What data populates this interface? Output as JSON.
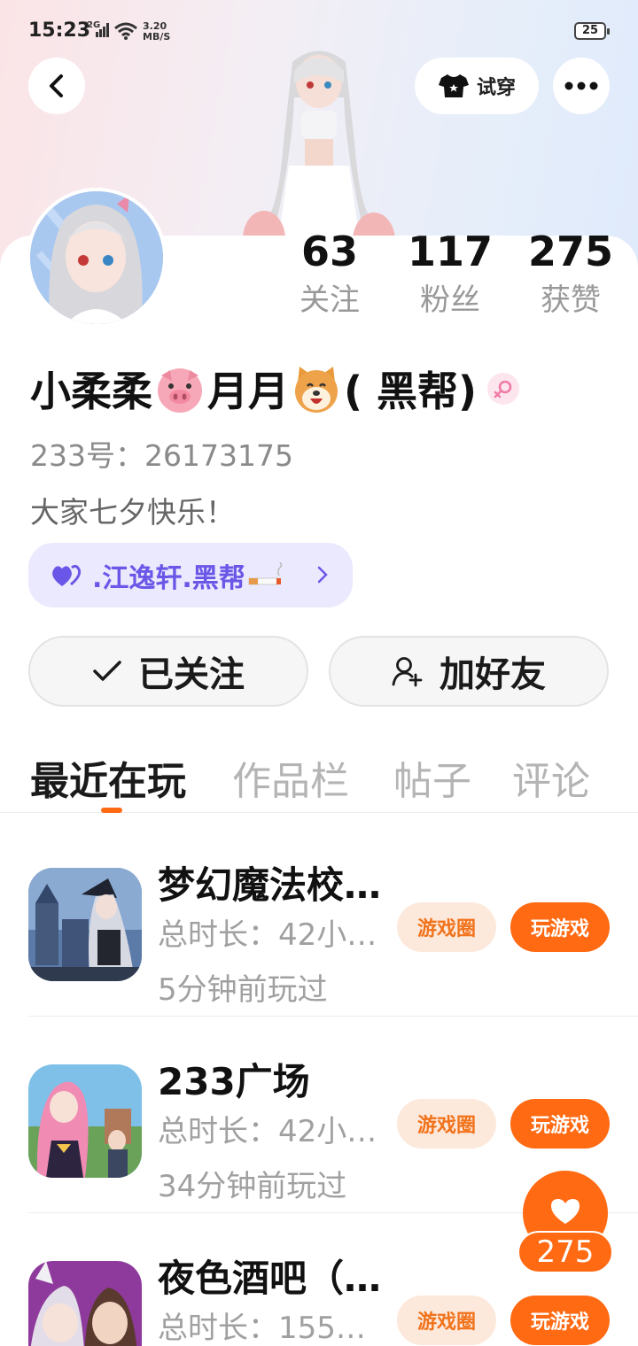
{
  "status_bar": {
    "time": "15:23",
    "network": "2G",
    "speed_value": "3.20",
    "speed_unit": "MB/S",
    "battery": "25"
  },
  "header": {
    "try_on_label": "试穿"
  },
  "profile": {
    "stats": [
      {
        "value": "63",
        "label": "关注"
      },
      {
        "value": "117",
        "label": "粉丝"
      },
      {
        "value": "275",
        "label": "获赞"
      }
    ],
    "nickname_part1": "小柔柔",
    "nickname_part2": "月月",
    "nickname_part3": "( 黑帮)",
    "uid": "233号：26173175",
    "bio": "大家七夕快乐！",
    "family_tag": ".江逸轩.黑帮"
  },
  "actions": {
    "follow_label": "已关注",
    "add_friend_label": "加好友"
  },
  "tabs": [
    "最近在玩",
    "作品栏",
    "帖子",
    "评论"
  ],
  "games": [
    {
      "name": "梦幻魔法校…",
      "duration": "总时长：42小…",
      "last_played": "5分钟前玩过",
      "circle_label": "游戏圈",
      "play_label": "玩游戏"
    },
    {
      "name": "233广场",
      "duration": "总时长：42小…",
      "last_played": "34分钟前玩过",
      "circle_label": "游戏圈",
      "play_label": "玩游戏"
    },
    {
      "name": "夜色酒吧（…",
      "duration": "总时长：155…",
      "last_played": "",
      "circle_label": "游戏圈",
      "play_label": "玩游戏"
    }
  ],
  "like_float": {
    "count": "275"
  },
  "colors": {
    "accent": "#ff6a13",
    "family_text": "#6a57e8",
    "family_bg": "#ebe9fd"
  }
}
